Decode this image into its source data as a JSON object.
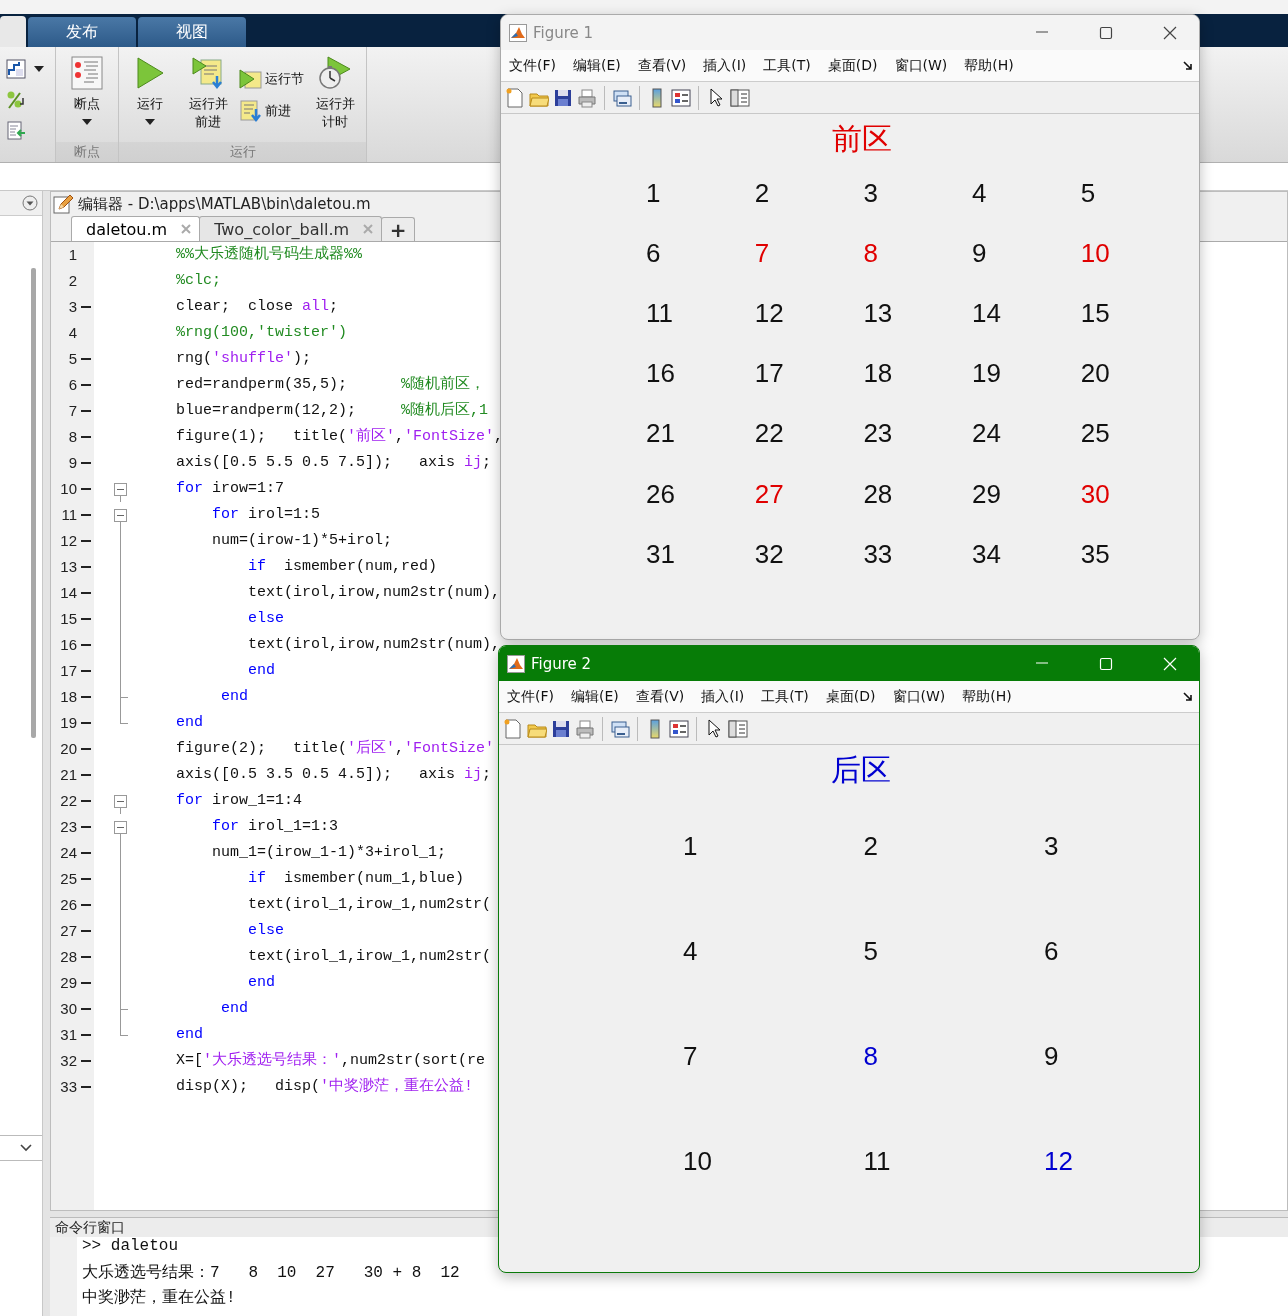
{
  "ribbon": {
    "tabs": [
      {
        "label": "发布",
        "selected": false
      },
      {
        "label": "视图",
        "selected": false
      }
    ],
    "groups": [
      {
        "label": "断点",
        "buttons": [
          {
            "label": "断点",
            "kind": "large",
            "dropdown": true
          }
        ]
      },
      {
        "label": "运行",
        "buttons": [
          {
            "label": "运行",
            "kind": "large",
            "dropdown": true
          },
          {
            "label": "运行并前进",
            "kind": "large",
            "dropdown": false
          },
          {
            "label": "运行节",
            "kind": "small",
            "dropdown": false
          },
          {
            "label": "前进",
            "kind": "small",
            "dropdown": false
          },
          {
            "label": "运行并计时",
            "kind": "large",
            "dropdown": false
          }
        ]
      }
    ]
  },
  "editor": {
    "title": "编辑器 - D:\\apps\\MATLAB\\bin\\daletou.m",
    "tabs": [
      {
        "label": "daletou.m",
        "selected": true
      },
      {
        "label": "Two_color_ball.m",
        "selected": false
      }
    ],
    "new_tab": "+",
    "lines": [
      {
        "number": "1",
        "executable": false,
        "kind": "plain",
        "segments": [
          {
            "kind": "comment",
            "text": "%%大乐透随机号码生成器%%"
          }
        ]
      },
      {
        "number": "2",
        "executable": false,
        "kind": "plain",
        "segments": [
          {
            "kind": "comment",
            "text": "%clc;"
          }
        ]
      },
      {
        "number": "3",
        "executable": true,
        "kind": "plain",
        "segments": [
          {
            "kind": "code",
            "text": "clear;  close "
          },
          {
            "kind": "string",
            "text": "all"
          },
          {
            "kind": "code",
            "text": ";"
          }
        ]
      },
      {
        "number": "4",
        "executable": false,
        "kind": "plain",
        "segments": [
          {
            "kind": "comment",
            "text": "%rng(100,'twister')"
          }
        ]
      },
      {
        "number": "5",
        "executable": true,
        "kind": "plain",
        "segments": [
          {
            "kind": "code",
            "text": "rng("
          },
          {
            "kind": "string",
            "text": "'shuffle'"
          },
          {
            "kind": "code",
            "text": ");"
          }
        ]
      },
      {
        "number": "6",
        "executable": true,
        "kind": "plain",
        "segments": [
          {
            "kind": "code",
            "text": "red=randperm(35,5);      "
          },
          {
            "kind": "comment",
            "text": "%随机前区，"
          }
        ]
      },
      {
        "number": "7",
        "executable": true,
        "kind": "plain",
        "segments": [
          {
            "kind": "code",
            "text": "blue=randperm(12,2);     "
          },
          {
            "kind": "comment",
            "text": "%随机后区,1"
          }
        ]
      },
      {
        "number": "8",
        "executable": true,
        "kind": "plain",
        "segments": [
          {
            "kind": "code",
            "text": "figure(1);   title("
          },
          {
            "kind": "string",
            "text": "'前区'"
          },
          {
            "kind": "code",
            "text": ","
          },
          {
            "kind": "string",
            "text": "'FontSize'"
          },
          {
            "kind": "code",
            "text": ","
          }
        ]
      },
      {
        "number": "9",
        "executable": true,
        "kind": "plain",
        "segments": [
          {
            "kind": "code",
            "text": "axis([0.5 5.5 0.5 7.5]);   axis "
          },
          {
            "kind": "string",
            "text": "ij"
          },
          {
            "kind": "code",
            "text": ";"
          }
        ]
      },
      {
        "number": "10",
        "executable": true,
        "kind": "start",
        "segments": [
          {
            "kind": "keyword",
            "text": "for"
          },
          {
            "kind": "code",
            "text": " irow=1:7"
          }
        ]
      },
      {
        "number": "11",
        "executable": true,
        "kind": "start",
        "segments": [
          {
            "kind": "keyword",
            "text": "    for"
          },
          {
            "kind": "code",
            "text": " irol=1:5"
          }
        ]
      },
      {
        "number": "12",
        "executable": true,
        "kind": "guide",
        "segments": [
          {
            "kind": "code",
            "text": "    num=(irow-1)*5+irol;"
          }
        ]
      },
      {
        "number": "13",
        "executable": true,
        "kind": "guide",
        "segments": [
          {
            "kind": "keyword",
            "text": "        if"
          },
          {
            "kind": "code",
            "text": "  ismember(num,red)"
          }
        ]
      },
      {
        "number": "14",
        "executable": true,
        "kind": "guide",
        "segments": [
          {
            "kind": "code",
            "text": "        text(irol,irow,num2str(num),"
          }
        ]
      },
      {
        "number": "15",
        "executable": true,
        "kind": "guide",
        "segments": [
          {
            "kind": "keyword",
            "text": "        else"
          }
        ]
      },
      {
        "number": "16",
        "executable": true,
        "kind": "guide",
        "segments": [
          {
            "kind": "code",
            "text": "        text(irol,irow,num2str(num),"
          }
        ]
      },
      {
        "number": "17",
        "executable": true,
        "kind": "guide",
        "segments": [
          {
            "kind": "keyword",
            "text": "        end"
          }
        ]
      },
      {
        "number": "18",
        "executable": true,
        "kind": "tick",
        "segments": [
          {
            "kind": "keyword",
            "text": "     end"
          }
        ]
      },
      {
        "number": "19",
        "executable": true,
        "kind": "end",
        "segments": [
          {
            "kind": "keyword",
            "text": "end"
          }
        ]
      },
      {
        "number": "20",
        "executable": true,
        "kind": "plain",
        "segments": [
          {
            "kind": "code",
            "text": "figure(2);   title("
          },
          {
            "kind": "string",
            "text": "'后区'"
          },
          {
            "kind": "code",
            "text": ","
          },
          {
            "kind": "string",
            "text": "'FontSize'"
          }
        ]
      },
      {
        "number": "21",
        "executable": true,
        "kind": "plain",
        "segments": [
          {
            "kind": "code",
            "text": "axis([0.5 3.5 0.5 4.5]);   axis "
          },
          {
            "kind": "string",
            "text": "ij"
          },
          {
            "kind": "code",
            "text": ";"
          }
        ]
      },
      {
        "number": "22",
        "executable": true,
        "kind": "start",
        "segments": [
          {
            "kind": "keyword",
            "text": "for"
          },
          {
            "kind": "code",
            "text": " irow_1=1:4"
          }
        ]
      },
      {
        "number": "23",
        "executable": true,
        "kind": "start",
        "segments": [
          {
            "kind": "keyword",
            "text": "    for"
          },
          {
            "kind": "code",
            "text": " irol_1=1:3"
          }
        ]
      },
      {
        "number": "24",
        "executable": true,
        "kind": "guide",
        "segments": [
          {
            "kind": "code",
            "text": "    num_1=(irow_1-1)*3+irol_1;"
          }
        ]
      },
      {
        "number": "25",
        "executable": true,
        "kind": "guide",
        "segments": [
          {
            "kind": "keyword",
            "text": "        if"
          },
          {
            "kind": "code",
            "text": "  ismember(num_1,blue)"
          }
        ]
      },
      {
        "number": "26",
        "executable": true,
        "kind": "guide",
        "segments": [
          {
            "kind": "code",
            "text": "        text(irol_1,irow_1,num2str("
          }
        ]
      },
      {
        "number": "27",
        "executable": true,
        "kind": "guide",
        "segments": [
          {
            "kind": "keyword",
            "text": "        else"
          }
        ]
      },
      {
        "number": "28",
        "executable": true,
        "kind": "guide",
        "segments": [
          {
            "kind": "code",
            "text": "        text(irol_1,irow_1,num2str("
          }
        ]
      },
      {
        "number": "29",
        "executable": true,
        "kind": "guide",
        "segments": [
          {
            "kind": "keyword",
            "text": "        end"
          }
        ]
      },
      {
        "number": "30",
        "executable": true,
        "kind": "tick",
        "segments": [
          {
            "kind": "keyword",
            "text": "     end"
          }
        ]
      },
      {
        "number": "31",
        "executable": true,
        "kind": "end",
        "segments": [
          {
            "kind": "keyword",
            "text": "end"
          }
        ]
      },
      {
        "number": "32",
        "executable": true,
        "kind": "plain",
        "segments": [
          {
            "kind": "code",
            "text": "X=["
          },
          {
            "kind": "string",
            "text": "'大乐透选号结果：'"
          },
          {
            "kind": "code",
            "text": ",num2str(sort(re"
          }
        ]
      },
      {
        "number": "33",
        "executable": true,
        "kind": "plain",
        "segments": [
          {
            "kind": "code",
            "text": "disp(X);   disp("
          },
          {
            "kind": "string",
            "text": "'中奖渺茫，重在公益!"
          }
        ]
      }
    ]
  },
  "command_window": {
    "title": "命令行窗口",
    "lines": [
      ">> daletou",
      "大乐透选号结果：7   8  10  27   30 + 8  12",
      "中奖渺茫，重在公益!"
    ]
  },
  "figures": [
    {
      "title": "Figure 1",
      "active": false,
      "kind": "front",
      "color": "#e00000",
      "plot_title": "前区",
      "menu": [
        "文件(F)",
        "编辑(E)",
        "查看(V)",
        "插入(I)",
        "工具(T)",
        "桌面(D)",
        "窗口(W)",
        "帮助(H)"
      ],
      "numbers": [
        {
          "text": "1",
          "selected": false
        },
        {
          "text": "2",
          "selected": false
        },
        {
          "text": "3",
          "selected": false
        },
        {
          "text": "4",
          "selected": false
        },
        {
          "text": "5",
          "selected": false
        },
        {
          "text": "6",
          "selected": false
        },
        {
          "text": "7",
          "selected": true
        },
        {
          "text": "8",
          "selected": true
        },
        {
          "text": "9",
          "selected": false
        },
        {
          "text": "10",
          "selected": true
        },
        {
          "text": "11",
          "selected": false
        },
        {
          "text": "12",
          "selected": false
        },
        {
          "text": "13",
          "selected": false
        },
        {
          "text": "14",
          "selected": false
        },
        {
          "text": "15",
          "selected": false
        },
        {
          "text": "16",
          "selected": false
        },
        {
          "text": "17",
          "selected": false
        },
        {
          "text": "18",
          "selected": false
        },
        {
          "text": "19",
          "selected": false
        },
        {
          "text": "20",
          "selected": false
        },
        {
          "text": "21",
          "selected": false
        },
        {
          "text": "22",
          "selected": false
        },
        {
          "text": "23",
          "selected": false
        },
        {
          "text": "24",
          "selected": false
        },
        {
          "text": "25",
          "selected": false
        },
        {
          "text": "26",
          "selected": false
        },
        {
          "text": "27",
          "selected": true
        },
        {
          "text": "28",
          "selected": false
        },
        {
          "text": "29",
          "selected": false
        },
        {
          "text": "30",
          "selected": true
        },
        {
          "text": "31",
          "selected": false
        },
        {
          "text": "32",
          "selected": false
        },
        {
          "text": "33",
          "selected": false
        },
        {
          "text": "34",
          "selected": false
        },
        {
          "text": "35",
          "selected": false
        }
      ]
    },
    {
      "title": "Figure 2",
      "active": true,
      "kind": "back",
      "color": "#0000d0",
      "plot_title": "后区",
      "menu": [
        "文件(F)",
        "编辑(E)",
        "查看(V)",
        "插入(I)",
        "工具(T)",
        "桌面(D)",
        "窗口(W)",
        "帮助(H)"
      ],
      "numbers": [
        {
          "text": "1",
          "selected": false
        },
        {
          "text": "2",
          "selected": false
        },
        {
          "text": "3",
          "selected": false
        },
        {
          "text": "4",
          "selected": false
        },
        {
          "text": "5",
          "selected": false
        },
        {
          "text": "6",
          "selected": false
        },
        {
          "text": "7",
          "selected": false
        },
        {
          "text": "8",
          "selected": true
        },
        {
          "text": "9",
          "selected": false
        },
        {
          "text": "10",
          "selected": false
        },
        {
          "text": "11",
          "selected": false
        },
        {
          "text": "12",
          "selected": true
        }
      ]
    }
  ]
}
